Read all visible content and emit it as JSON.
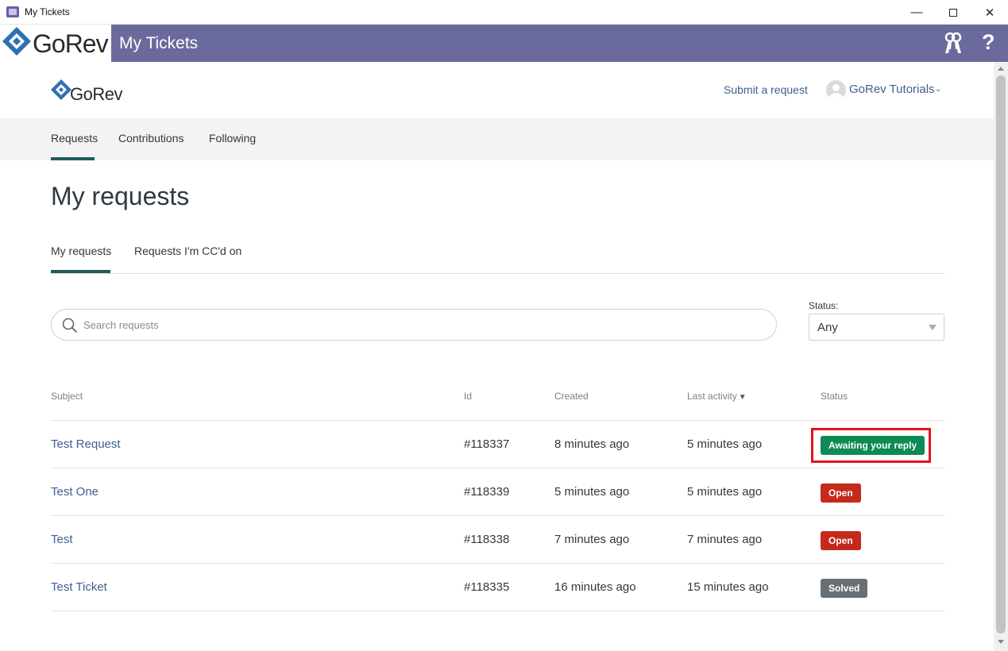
{
  "window": {
    "title": "My Tickets",
    "controls": {
      "minimize": "—",
      "close": "✕"
    }
  },
  "appbar": {
    "brand": "GoRev",
    "title": "My Tickets",
    "help": "?",
    "colors": {
      "bar": "#6b6a9c",
      "brand_blue": "#2f6fb5"
    },
    "icons": [
      "gorev-logo-icon",
      "keys-icon",
      "help-icon"
    ]
  },
  "header": {
    "logo_text": "GoRev",
    "submit_request": "Submit a request",
    "user_name": "GoRev Tutorials",
    "user_chevron": "⌄"
  },
  "subnav": {
    "items": [
      {
        "label": "Requests",
        "active": true
      },
      {
        "label": "Contributions",
        "active": false
      },
      {
        "label": "Following",
        "active": false
      }
    ]
  },
  "main": {
    "title": "My requests",
    "tabs": [
      {
        "label": "My requests",
        "active": true
      },
      {
        "label": "Requests I'm CC'd on",
        "active": false
      }
    ],
    "search": {
      "placeholder": "Search requests",
      "value": ""
    },
    "status_filter": {
      "label": "Status:",
      "value": "Any"
    }
  },
  "table": {
    "columns": [
      "Subject",
      "Id",
      "Created",
      "Last activity",
      "Status"
    ],
    "sort_indicator": "▼",
    "rows": [
      {
        "subject": "Test Request",
        "id": "#118337",
        "created": "8 minutes ago",
        "last_activity": "5 minutes ago",
        "status": "Awaiting your reply",
        "status_color": "#0e8a54",
        "highlighted": true
      },
      {
        "subject": "Test One",
        "id": "#118339",
        "created": "5 minutes ago",
        "last_activity": "5 minutes ago",
        "status": "Open",
        "status_color": "#c42a1c"
      },
      {
        "subject": "Test",
        "id": "#118338",
        "created": "7 minutes ago",
        "last_activity": "7 minutes ago",
        "status": "Open",
        "status_color": "#c42a1c"
      },
      {
        "subject": "Test Ticket",
        "id": "#118335",
        "created": "16 minutes ago",
        "last_activity": "15 minutes ago",
        "status": "Solved",
        "status_color": "#687077"
      }
    ]
  }
}
